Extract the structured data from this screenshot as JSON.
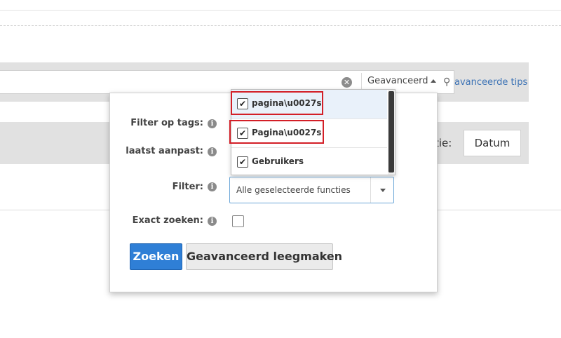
{
  "search": {
    "advanced_label": "Geavanceerd",
    "tips_link": "avanceerde tips",
    "clear_glyph": "✕",
    "search_glyph": "⚲"
  },
  "sort": {
    "label_fragment": "tie:",
    "datum_button": "Datum"
  },
  "advanced_panel": {
    "tags_label": "Filter op tags:",
    "modified_label": "laatst aanpast:",
    "filter_label": "Filter:",
    "filter_value": "Alle geselecteerde functies",
    "exact_label": "Exact zoeken:",
    "exact_checked": false,
    "info_glyph": "i",
    "search_button": "Zoeken",
    "clear_button": "Geavanceerd leegmaken"
  },
  "dropdown": {
    "options": [
      {
        "label": "pagina\\u0027s",
        "checked": true,
        "highlighted": true
      },
      {
        "label": "Pagina\\u0027s",
        "checked": true,
        "highlighted": true
      },
      {
        "label": "Gebruikers",
        "checked": true,
        "highlighted": false
      }
    ],
    "check_glyph": "✔"
  },
  "colors": {
    "primary_button": "#2f7fd6",
    "highlight_border": "#d31f27",
    "link": "#3d73b5"
  }
}
